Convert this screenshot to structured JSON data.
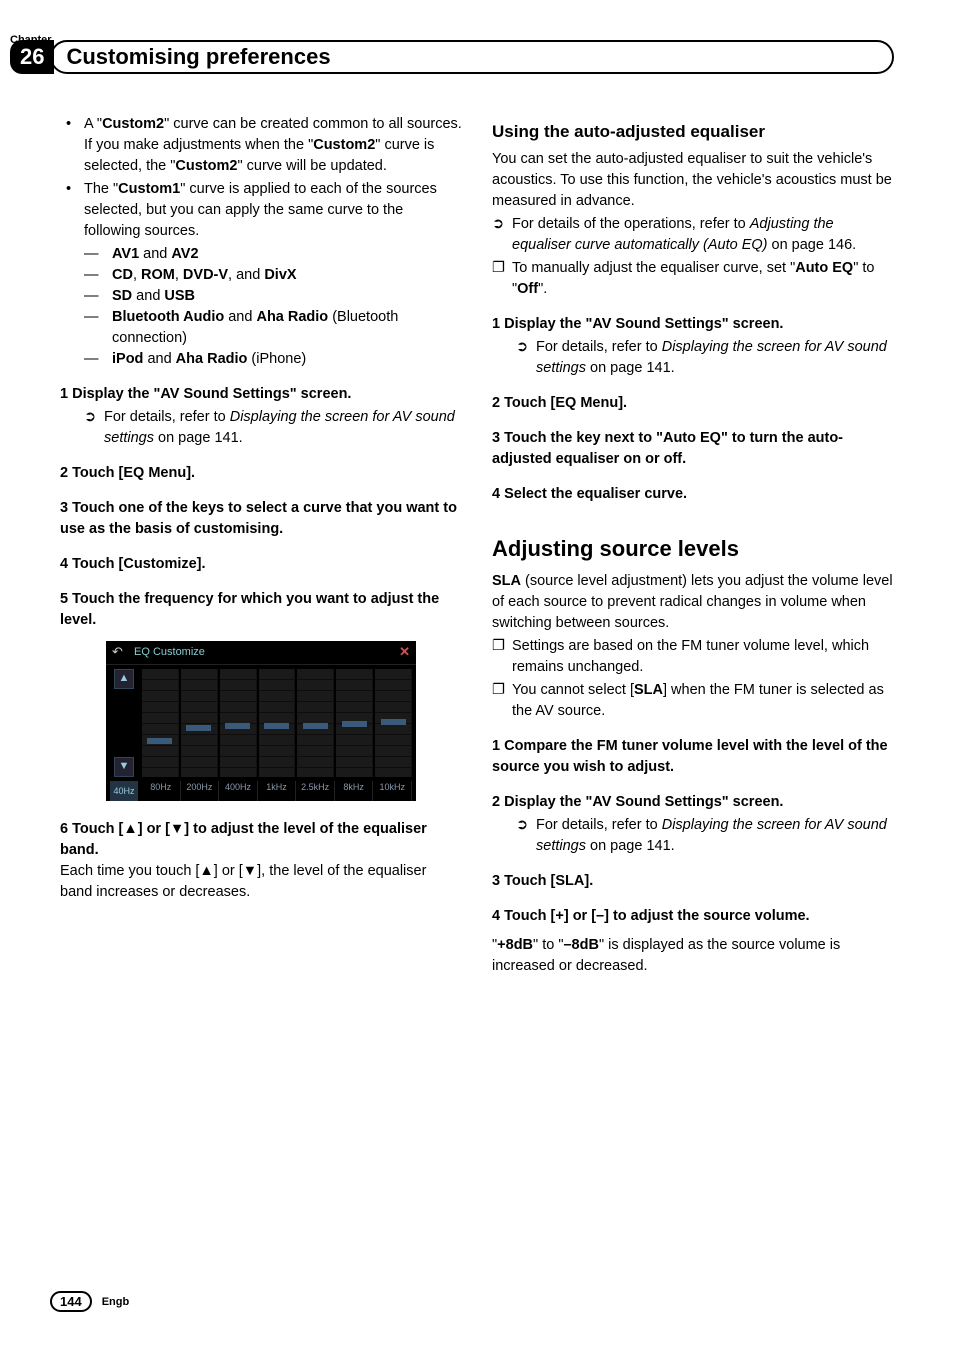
{
  "header": {
    "chapter_label": "Chapter",
    "chapter_num": "26",
    "title": "Customising preferences"
  },
  "left": {
    "bullet1": {
      "pre": "A \"",
      "b1": "Custom2",
      "mid1": "\" curve can be created common to all sources. If you make adjustments when the \"",
      "b2": "Custom2",
      "mid2": "\" curve is selected, the \"",
      "b3": "Custom2",
      "post": "\" curve will be updated."
    },
    "bullet2": {
      "pre": "The \"",
      "b1": "Custom1",
      "post": "\" curve is applied to each of the sources selected, but you can apply the same curve to the following sources."
    },
    "sub": {
      "s1a": "AV1",
      "s1b": " and ",
      "s1c": "AV2",
      "s2a": "CD",
      "s2b": ", ",
      "s2c": "ROM",
      "s2d": ", ",
      "s2e": "DVD-V",
      "s2f": ", and ",
      "s2g": "DivX",
      "s3a": "SD",
      "s3b": " and ",
      "s3c": "USB",
      "s4a": "Bluetooth Audio",
      "s4b": " and ",
      "s4c": "Aha Radio",
      "s4d": " (Bluetooth connection)",
      "s5a": "iPod",
      "s5b": " and ",
      "s5c": "Aha Radio",
      "s5d": " (iPhone)"
    },
    "step1": "1    Display the \"AV Sound Settings\" screen.",
    "ref1a": "For details, refer to ",
    "ref1b": "Displaying the screen for AV sound settings",
    "ref1c": " on page 141.",
    "step2": "2    Touch [EQ Menu].",
    "step3": "3    Touch one of the keys to select a curve that you want to use as the basis of customising.",
    "step4": "4    Touch [Customize].",
    "step5": "5    Touch the frequency for which you want to adjust the level.",
    "step6": "6    Touch [▲] or [▼] to adjust the level of the equaliser band.",
    "step6_body": "Each time you touch [▲] or [▼], the level of the equaliser band increases or decreases."
  },
  "eq": {
    "title": "EQ Customize",
    "sel_freq": "40Hz",
    "labels": [
      "80Hz",
      "200Hz",
      "400Hz",
      "1kHz",
      "2.5kHz",
      "8kHz",
      "10kHz"
    ],
    "up": "▲",
    "down": "▼",
    "back": "↶",
    "close": "✕"
  },
  "right": {
    "h2a": "Using the auto-adjusted equaliser",
    "p1": "You can set the auto-adjusted equaliser to suit the vehicle's acoustics. To use this function, the vehicle's acoustics must be measured in advance.",
    "ref2a": "For details of the operations, refer to ",
    "ref2b": "Adjusting the equaliser curve automatically (Auto EQ)",
    "ref2c": " on page 146.",
    "note1a": "To manually adjust the equaliser curve, set \"",
    "note1b": "Auto EQ",
    "note1c": "\" to \"",
    "note1d": "Off",
    "note1e": "\".",
    "stepA1": "1    Display the \"AV Sound Settings\" screen.",
    "refA1a": "For details, refer to ",
    "refA1b": "Displaying the screen for AV sound settings",
    "refA1c": " on page 141.",
    "stepA2": "2    Touch [EQ Menu].",
    "stepA3": "3    Touch the key next to \"Auto EQ\" to turn the auto-adjusted equaliser on or off.",
    "stepA4": "4    Select the equaliser curve.",
    "h1b": "Adjusting source levels",
    "p2a": "SLA",
    "p2b": " (source level adjustment) lets you adjust the volume level of each source to prevent radical changes in volume when switching between sources.",
    "noteB1": "Settings are based on the FM tuner volume level, which remains unchanged.",
    "noteB2a": "You cannot select [",
    "noteB2b": "SLA",
    "noteB2c": "] when the FM tuner is selected as the AV source.",
    "stepB1": "1    Compare the FM tuner volume level with the level of the source you wish to adjust.",
    "stepB2": "2    Display the \"AV Sound Settings\" screen.",
    "refB2a": "For details, refer to ",
    "refB2b": "Displaying the screen for AV sound settings",
    "refB2c": " on page 141.",
    "stepB3": "3    Touch [SLA].",
    "stepB4": "4    Touch [+] or [–] to adjust the source volume.",
    "p3a": "\"",
    "p3b": "+8dB",
    "p3c": "\" to \"",
    "p3d": "–8dB",
    "p3e": "\" is displayed as the source volume is increased or decreased."
  },
  "footer": {
    "page": "144",
    "lang": "Engb"
  },
  "markers": {
    "bullet": "•",
    "dash": "—",
    "arrow": "➲",
    "square": "❐"
  }
}
